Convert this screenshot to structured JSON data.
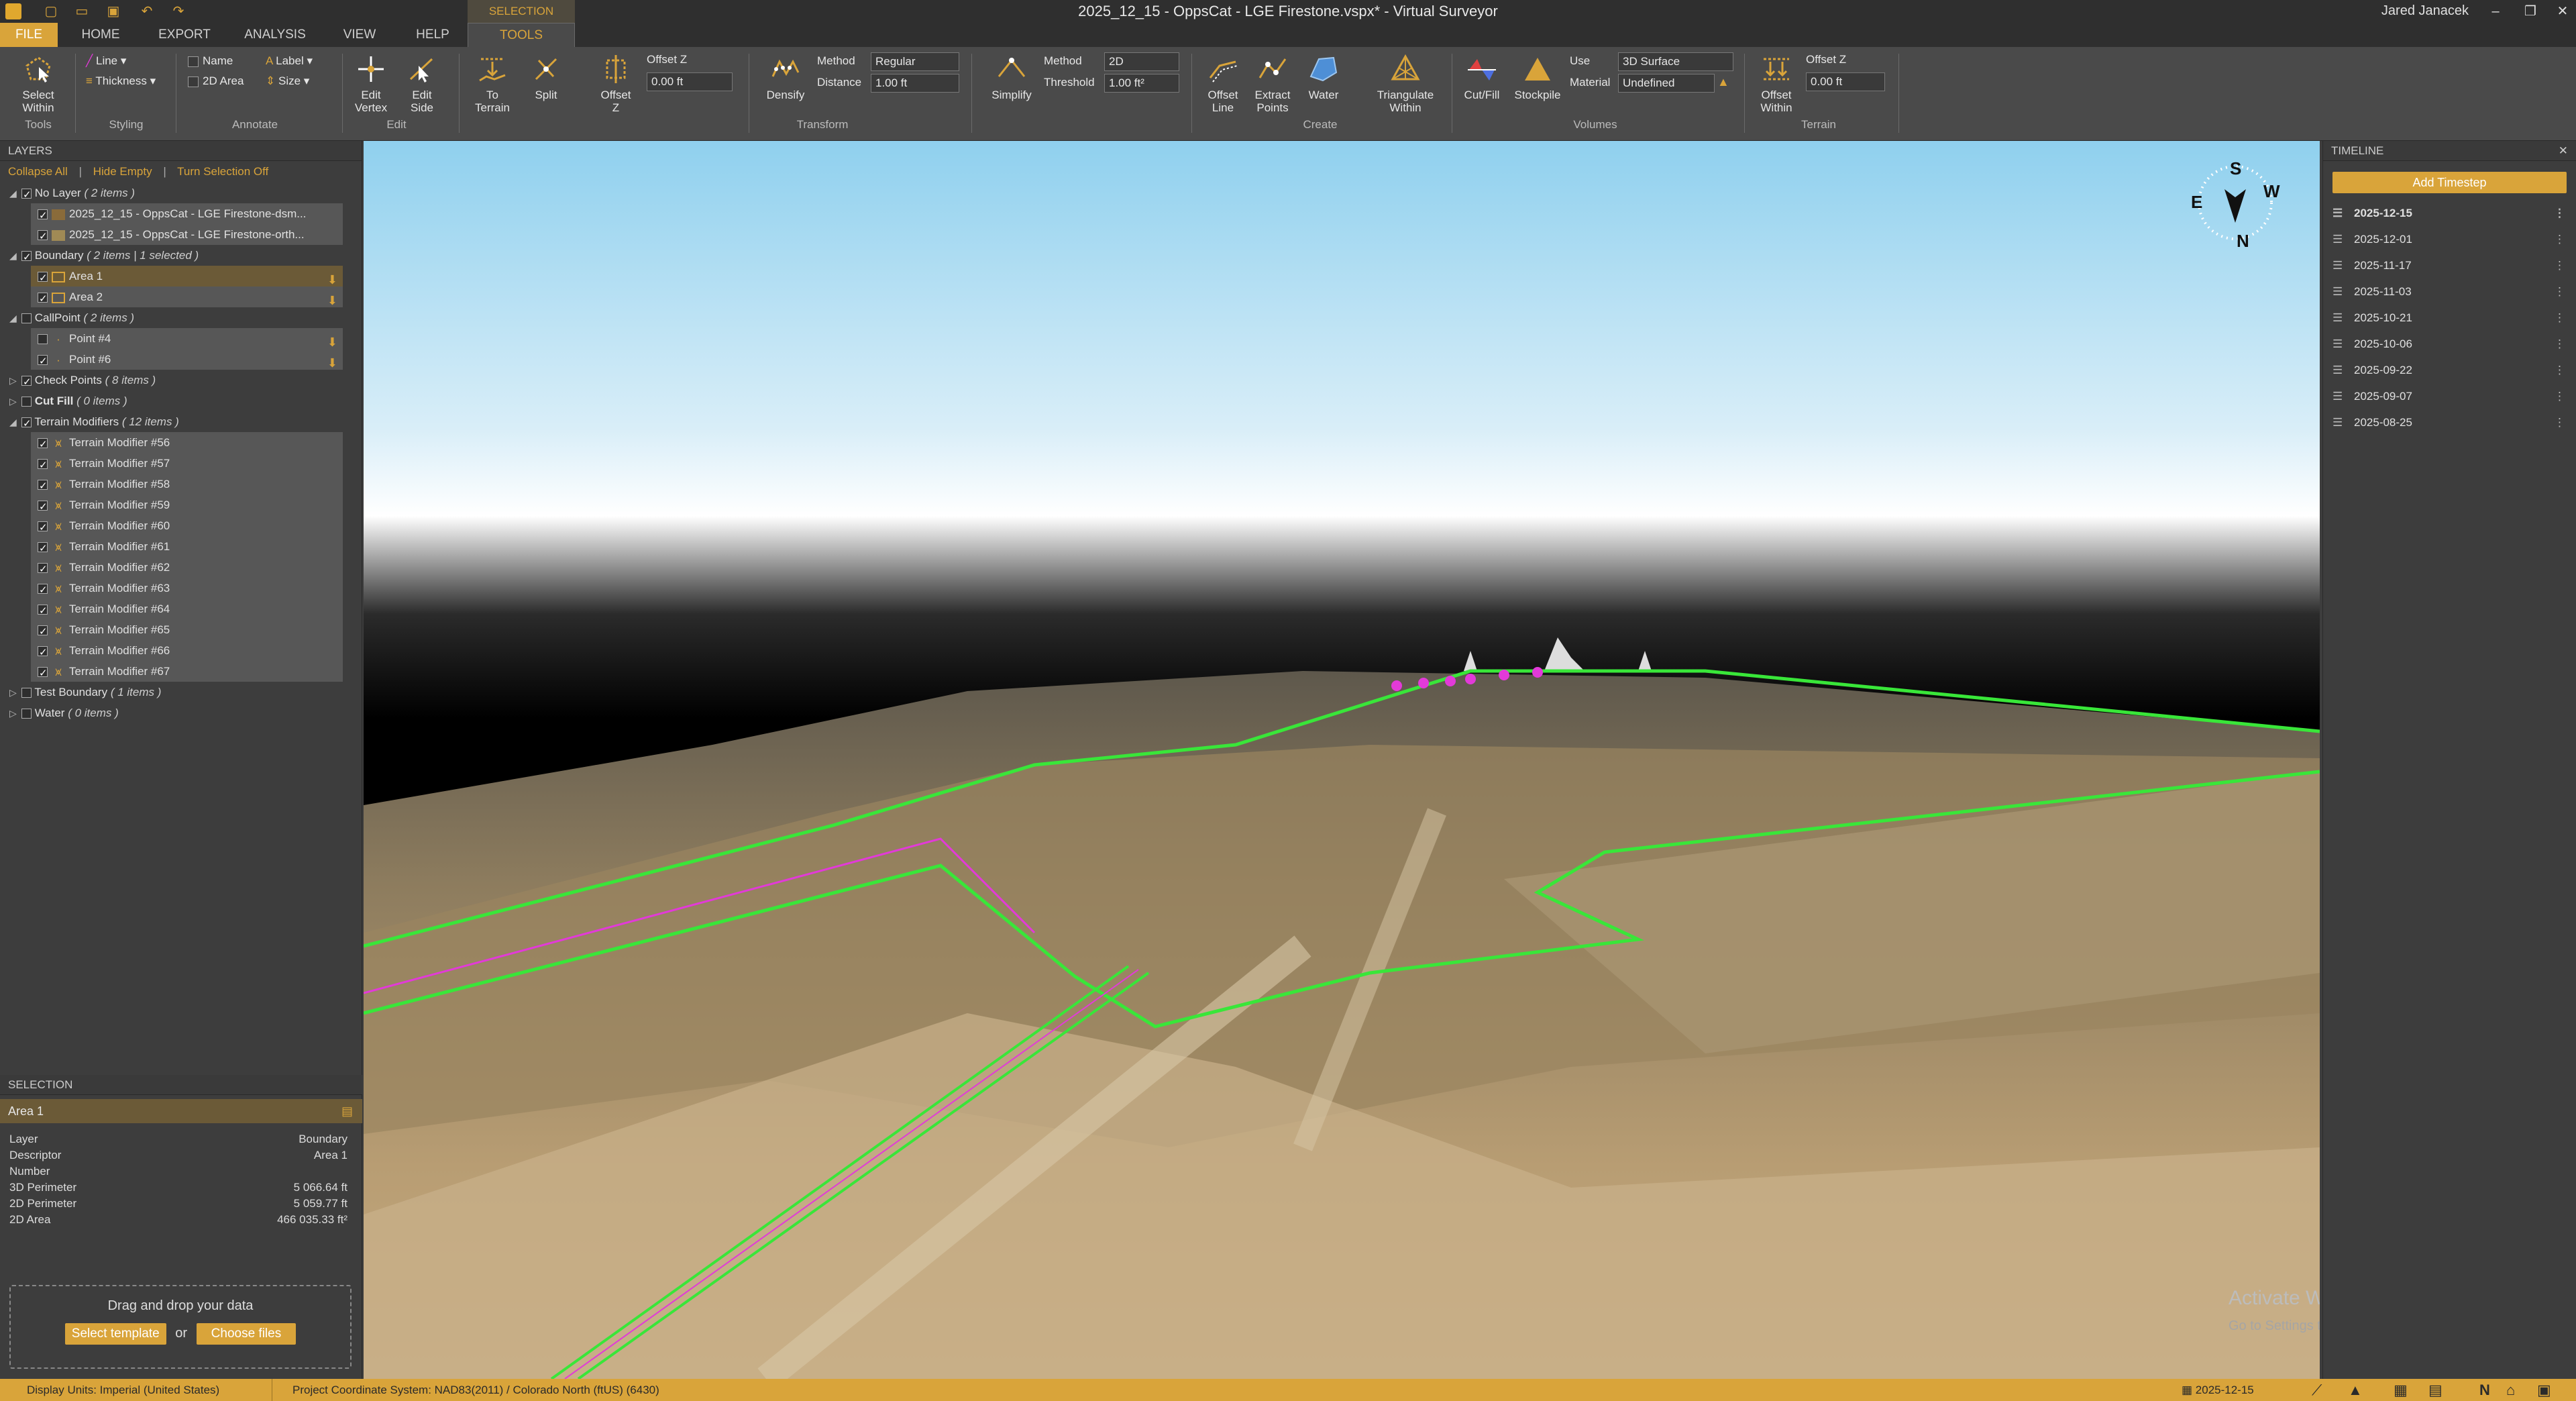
{
  "window": {
    "title": "2025_12_15 - OppsCat - LGE Firestone.vspx* - Virtual Surveyor",
    "user": "Jared Janacek",
    "min": "–",
    "max": "❐",
    "close": "✕"
  },
  "tabs": {
    "context_group": "SELECTION",
    "items": [
      "FILE",
      "HOME",
      "EXPORT",
      "ANALYSIS",
      "VIEW",
      "HELP",
      "TOOLS"
    ]
  },
  "ribbon": {
    "tools": {
      "select_within": "Select\nWithin",
      "group": "Tools"
    },
    "styling": {
      "line": "Line",
      "thickness": "Thickness",
      "group": "Styling"
    },
    "annotate": {
      "name": "Name",
      "area2d": "2D Area",
      "label": "Label",
      "size": "Size",
      "group": "Annotate"
    },
    "edit": {
      "edit_vertex": "Edit\nVertex",
      "edit_side": "Edit\nSide",
      "group": "Edit"
    },
    "transform": {
      "to_terrain": "To\nTerrain",
      "split": "Split",
      "offset_z": "Offset\nZ",
      "offset_z_label": "Offset Z",
      "offset_z_value": "0.00 ft",
      "densify": "Densify",
      "method_label": "Method",
      "method_value": "Regular",
      "distance_label": "Distance",
      "distance_value": "1.00 ft",
      "simplify": "Simplify",
      "method2_label": "Method",
      "method2_value": "2D",
      "threshold_label": "Threshold",
      "threshold_value": "1.00 ft²",
      "group": "Transform"
    },
    "create": {
      "offset_line": "Offset\nLine",
      "extract_points": "Extract\nPoints",
      "water": "Water",
      "triangulate": "Triangulate\nWithin",
      "group": "Create"
    },
    "volumes": {
      "cutfill": "Cut/Fill",
      "stockpile": "Stockpile",
      "use_label": "Use",
      "use_value": "3D Surface",
      "material_label": "Material",
      "material_value": "Undefined",
      "group": "Volumes"
    },
    "terrain": {
      "offset_within": "Offset\nWithin",
      "offset_z_label": "Offset Z",
      "offset_z_value": "0.00 ft",
      "group": "Terrain"
    }
  },
  "layers": {
    "title": "LAYERS",
    "collapse": "Collapse All",
    "hide_empty": "Hide Empty",
    "turn_off": "Turn Selection Off",
    "groups": [
      {
        "name": "No Layer",
        "count": "( 2 items )",
        "items": [
          "2025_12_15 - OppsCat - LGE Firestone-dsm...",
          "2025_12_15 - OppsCat - LGE Firestone-orth..."
        ]
      },
      {
        "name": "Boundary",
        "count": "( 2 items | 1 selected )",
        "items": [
          "Area 1",
          "Area 2"
        ]
      },
      {
        "name": "CallPoint",
        "count": "( 2 items )",
        "items": [
          "Point #4",
          "Point #6"
        ]
      },
      {
        "name": "Check Points",
        "count": "( 8 items )"
      },
      {
        "name": "Cut Fill",
        "count": "( 0 items )"
      },
      {
        "name": "Terrain Modifiers",
        "count": "( 12 items )",
        "items": [
          "Terrain Modifier #56",
          "Terrain Modifier #57",
          "Terrain Modifier #58",
          "Terrain Modifier #59",
          "Terrain Modifier #60",
          "Terrain Modifier #61",
          "Terrain Modifier #62",
          "Terrain Modifier #63",
          "Terrain Modifier #64",
          "Terrain Modifier #65",
          "Terrain Modifier #66",
          "Terrain Modifier #67"
        ]
      },
      {
        "name": "Test Boundary",
        "count": "( 1 items )"
      },
      {
        "name": "Water",
        "count": "( 0 items )"
      }
    ]
  },
  "selection": {
    "title": "SELECTION",
    "name": "Area 1",
    "rows": [
      [
        "Layer",
        "Boundary"
      ],
      [
        "Descriptor",
        "Area 1"
      ],
      [
        "Number",
        ""
      ],
      [
        "3D Perimeter",
        "5 066.64 ft"
      ],
      [
        "2D Perimeter",
        "5 059.77 ft"
      ],
      [
        "2D Area",
        "466 035.33 ft²"
      ]
    ]
  },
  "dropzone": {
    "text": "Drag and drop your data",
    "template": "Select template",
    "or": "or",
    "files": "Choose files"
  },
  "compass": {
    "s": "S",
    "e": "E",
    "w": "W",
    "n": "N"
  },
  "watermark": {
    "title": "Activate Windows",
    "sub": "Go to Settings to activate Windows."
  },
  "timeline": {
    "title": "TIMELINE",
    "add": "Add Timestep",
    "items": [
      "2025-12-15",
      "2025-12-01",
      "2025-11-17",
      "2025-11-03",
      "2025-10-21",
      "2025-10-06",
      "2025-09-22",
      "2025-09-07",
      "2025-08-25"
    ]
  },
  "status": {
    "units_label": "Display Units:",
    "units": "Imperial (United States)",
    "crs_label": "Project Coordinate System:",
    "crs": "NAD83(2011) / Colorado North (ftUS) (6430)",
    "date": "2025-12-15"
  },
  "colors": {
    "accent": "#d9a43a",
    "boundary": "#39e639",
    "callpoint": "#e23ad8"
  }
}
